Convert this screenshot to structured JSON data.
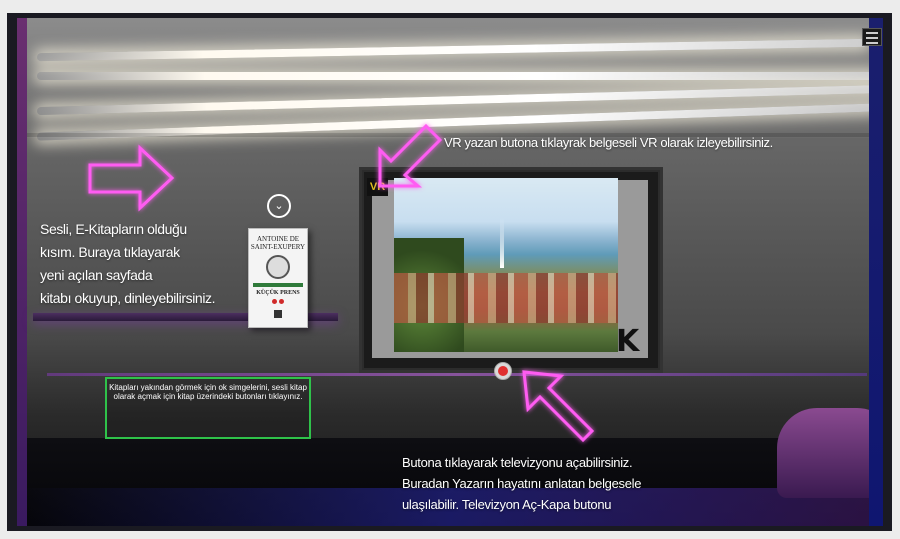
{
  "scene": {
    "left_caption_lines": [
      "Sesli, E-Kitapların olduğu",
      "kısım. Buraya tıklayarak",
      "yeni açılan sayfada",
      "kitabı okuyup, dinleyebilirsiniz."
    ],
    "vr_caption": "VR yazan butona tıklayrak belgeseli  VR olarak izleyebilirsiniz.",
    "bottom_caption_lines": [
      "Butona tıklayarak televizyonu açabilirsiniz.",
      "Buradan Yazarın hayatını anlatan belgesele",
      "ulaşılabilir.  Televizyon Aç-Kapa butonu"
    ],
    "hint_box": "Kitapları  yakından görmek için ok simgelerini, sesli kitap olarak açmak için kitap üzerindeki butonları tıklayınız."
  },
  "tv": {
    "vr_label": "VR",
    "logo_text": "K",
    "power_icon": "power-icon"
  },
  "book": {
    "author_line1": "ANTOINE DE",
    "author_line2": "SAINT-EXUPERY",
    "title": "KÜÇÜK PRENS",
    "chevron_icon": "chevron-down-icon"
  },
  "colors": {
    "arrow_neon": "#ff5cf2",
    "hint_border": "#2fc24a",
    "vr_badge_text": "#e0c020",
    "power_red": "#e03030"
  }
}
